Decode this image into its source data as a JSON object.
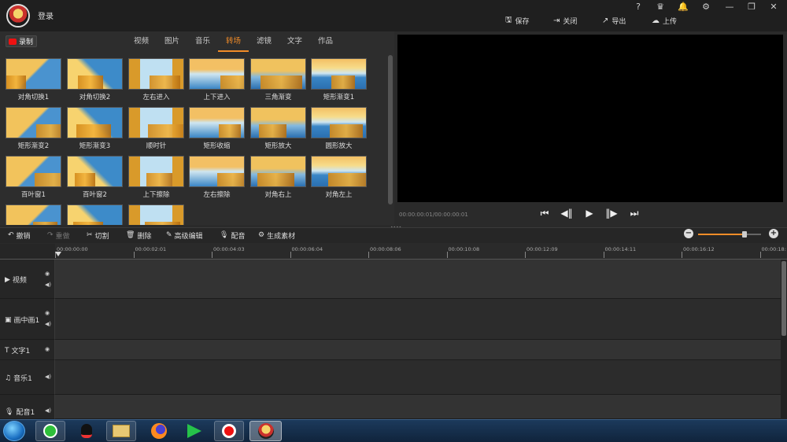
{
  "header": {
    "login_label": "登录",
    "window_controls": [
      "?",
      "crown-icon",
      "bell-icon",
      "gear-icon",
      "minimize-icon",
      "restore-icon",
      "close-icon"
    ],
    "actions": [
      {
        "label": "保存",
        "icon": "save-icon"
      },
      {
        "label": "关闭",
        "icon": "exit-icon"
      },
      {
        "label": "导出",
        "icon": "export-icon"
      },
      {
        "label": "上传",
        "icon": "upload-icon"
      }
    ]
  },
  "library": {
    "record_label": "录制",
    "tabs": [
      "视频",
      "图片",
      "音乐",
      "转场",
      "滤镜",
      "文字",
      "作品"
    ],
    "active_tab": "转场",
    "transitions": [
      "对角切换1",
      "对角切换2",
      "左右进入",
      "上下进入",
      "三角渐变",
      "矩形渐变1",
      "矩形渐变2",
      "矩形渐变3",
      "顺时针",
      "矩形收缩",
      "矩形放大",
      "圆形放大",
      "百叶窗1",
      "百叶窗2",
      "上下擦除",
      "左右擦除",
      "对角右上",
      "对角左上",
      "",
      "",
      ""
    ]
  },
  "preview": {
    "time": "00:00:00:01/00:00:00:01",
    "controls": [
      "skip-start-icon",
      "step-back-icon",
      "play-icon",
      "step-forward-icon",
      "skip-end-icon"
    ]
  },
  "toolbar": {
    "undo": "撤销",
    "redo": "重做",
    "cut": "切割",
    "delete": "删除",
    "advanced_edit": "高级编辑",
    "dub": "配音",
    "generate": "生成素材"
  },
  "ruler": {
    "labels": [
      "00:00:00:00",
      "00:00:02:01",
      "00:00:04:03",
      "00:00:06:04",
      "00:00:08:06",
      "00:00:10:08",
      "00:00:12:09",
      "00:00:14:11",
      "00:00:16:12",
      "00:00:18:"
    ]
  },
  "tracks": [
    {
      "name": "视频",
      "icon": "video-icon"
    },
    {
      "name": "画中画1",
      "icon": "pip-icon"
    },
    {
      "name": "文字1",
      "icon": "text-icon"
    },
    {
      "name": "音乐1",
      "icon": "music-icon"
    },
    {
      "name": "配音1",
      "icon": "mic-icon"
    }
  ],
  "taskbar": {
    "apps": [
      "start-orb-icon",
      "360-browser-icon",
      "qq-icon",
      "file-explorer-icon",
      "firefox-icon",
      "media-player-icon",
      "record-icon",
      "video-editor-icon"
    ]
  },
  "colors": {
    "accent": "#f28c28",
    "background": "#2a2a2a",
    "preview": "#000000",
    "record": "#e11111"
  }
}
